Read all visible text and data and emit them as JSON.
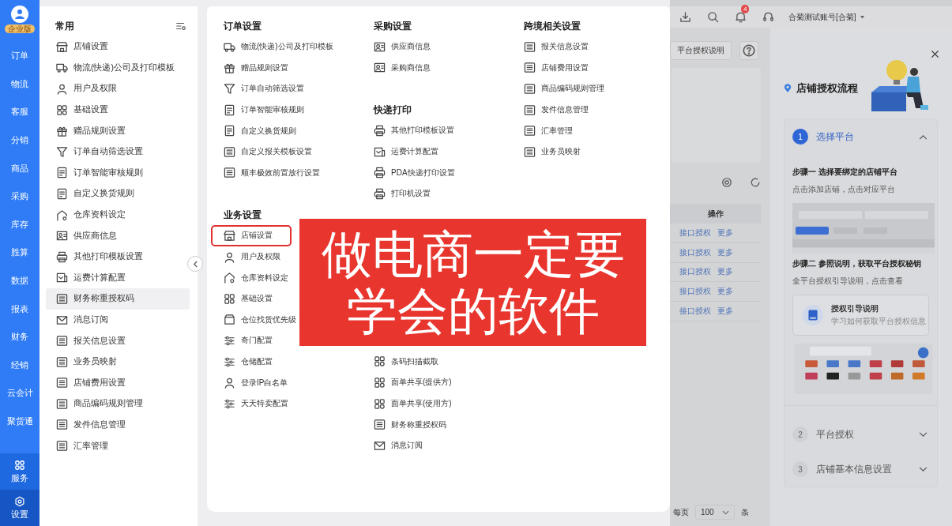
{
  "sidebar": {
    "logo_badge": "企业版",
    "items": [
      {
        "label": "订单",
        "selected": false
      },
      {
        "label": "物流",
        "selected": false
      },
      {
        "label": "客服",
        "selected": false
      },
      {
        "label": "分销",
        "selected": false
      },
      {
        "label": "商品",
        "selected": false
      },
      {
        "label": "采购",
        "selected": false
      },
      {
        "label": "库存",
        "selected": false
      },
      {
        "label": "胜算",
        "selected": false
      },
      {
        "label": "数据",
        "selected": false
      },
      {
        "label": "报表",
        "selected": false
      },
      {
        "label": "财务",
        "selected": false
      },
      {
        "label": "经销",
        "selected": false
      },
      {
        "label": "云会计",
        "selected": false
      },
      {
        "label": "聚货通",
        "selected": false
      }
    ],
    "bottom_items": [
      {
        "label": "服务",
        "kind": "apps",
        "selected": false
      },
      {
        "label": "设置",
        "kind": "settings",
        "selected": true
      }
    ]
  },
  "common_panel": {
    "title": "常用",
    "items": [
      {
        "label": "店铺设置",
        "kind": "store",
        "highlighted": false
      },
      {
        "label": "物流(快递)公司及打印模板",
        "kind": "truck",
        "highlighted": false
      },
      {
        "label": "用户及权限",
        "kind": "user",
        "highlighted": false
      },
      {
        "label": "基础设置",
        "kind": "grid",
        "highlighted": false
      },
      {
        "label": "赠品规则设置",
        "kind": "gift",
        "highlighted": false
      },
      {
        "label": "订单自动筛选设置",
        "kind": "filter",
        "highlighted": false
      },
      {
        "label": "订单智能审核规则",
        "kind": "note",
        "highlighted": false
      },
      {
        "label": "自定义换货规则",
        "kind": "note",
        "highlighted": false
      },
      {
        "label": "仓库资料设定",
        "kind": "house",
        "highlighted": false
      },
      {
        "label": "供应商信息",
        "kind": "card",
        "highlighted": false
      },
      {
        "label": "其他打印模板设置",
        "kind": "printer",
        "highlighted": false
      },
      {
        "label": "运费计算配置",
        "kind": "freight",
        "highlighted": false
      },
      {
        "label": "财务称重授权码",
        "kind": "doc",
        "highlighted": true
      },
      {
        "label": "消息订阅",
        "kind": "mail",
        "highlighted": false
      },
      {
        "label": "报关信息设置",
        "kind": "doc",
        "highlighted": false
      },
      {
        "label": "业务员映射",
        "kind": "doc",
        "highlighted": false
      },
      {
        "label": "店铺费用设置",
        "kind": "doc",
        "highlighted": false
      },
      {
        "label": "商品编码规则管理",
        "kind": "doc",
        "highlighted": false
      },
      {
        "label": "发件信息管理",
        "kind": "doc",
        "highlighted": false
      },
      {
        "label": "汇率管理",
        "kind": "doc",
        "highlighted": false
      }
    ]
  },
  "settings_panel": {
    "columns": [
      {
        "groups": [
          {
            "heading": "订单设置",
            "items": [
              {
                "label": "物流(快递)公司及打印模板",
                "kind": "truck"
              },
              {
                "label": "赠品规则设置",
                "kind": "gift"
              },
              {
                "label": "订单自动筛选设置",
                "kind": "filter"
              },
              {
                "label": "订单智能审核规则",
                "kind": "note"
              },
              {
                "label": "自定义换货规则",
                "kind": "note"
              },
              {
                "label": "自定义报关模板设置",
                "kind": "doc"
              },
              {
                "label": "顺丰极效前置放行设置",
                "kind": "doc"
              }
            ]
          },
          {
            "heading": "业务设置",
            "items": [
              {
                "label": "店铺设置",
                "kind": "store",
                "outlined": true
              },
              {
                "label": "用户及权限",
                "kind": "user",
                "outlined": false
              },
              {
                "label": "仓库资料设定",
                "kind": "house",
                "outlined": false
              },
              {
                "label": "基础设置",
                "kind": "grid",
                "outlined": false
              },
              {
                "label": "仓位找货优先级",
                "kind": "box",
                "outlined": false
              },
              {
                "label": "奇门配置",
                "kind": "sliders",
                "outlined": false
              },
              {
                "label": "仓储配置",
                "kind": "sliders",
                "outlined": false
              },
              {
                "label": "登录IP白名单",
                "kind": "user",
                "outlined": false
              },
              {
                "label": "天天特卖配置",
                "kind": "sliders",
                "outlined": false
              }
            ]
          }
        ]
      },
      {
        "groups": [
          {
            "heading": "采购设置",
            "items": [
              {
                "label": "供应商信息",
                "kind": "card"
              },
              {
                "label": "采购商信息",
                "kind": "card"
              }
            ]
          },
          {
            "heading": "快递打印",
            "items": [
              {
                "label": "其他打印模板设置",
                "kind": "printer"
              },
              {
                "label": "运费计算配置",
                "kind": "freight"
              },
              {
                "label": "PDA快递打印设置",
                "kind": "printer"
              },
              {
                "label": "打印机设置",
                "kind": "printer"
              }
            ]
          },
          {
            "items": [
              {
                "label": "条码扫描截取",
                "kind": "grid"
              },
              {
                "label": "面单共享(提供方)",
                "kind": "grid"
              },
              {
                "label": "面单共享(使用方)",
                "kind": "grid"
              },
              {
                "label": "财务称重授权码",
                "kind": "doc"
              },
              {
                "label": "消息订阅",
                "kind": "mail"
              }
            ]
          }
        ]
      },
      {
        "groups": [
          {
            "heading": "跨境相关设置",
            "items": [
              {
                "label": "报关信息设置",
                "kind": "doc"
              },
              {
                "label": "店铺费用设置",
                "kind": "doc"
              },
              {
                "label": "商品编码规则管理",
                "kind": "doc"
              },
              {
                "label": "发件信息管理",
                "kind": "doc"
              },
              {
                "label": "汇率管理",
                "kind": "doc"
              },
              {
                "label": "业务员映射",
                "kind": "doc"
              }
            ]
          }
        ]
      }
    ]
  },
  "caption": {
    "lines": [
      "做电商一定要",
      "学会的软件"
    ]
  },
  "top_bar": {
    "notification_count": "4",
    "account": "合菊测试账号[合菊]"
  },
  "main": {
    "button": "平台授权说明",
    "table": {
      "columns": [
        "操作"
      ],
      "rows": [
        {
          "actions": [
            "接口授权",
            "更多"
          ]
        },
        {
          "actions": [
            "接口授权",
            "更多"
          ]
        },
        {
          "actions": [
            "接口授权",
            "更多"
          ]
        },
        {
          "actions": [
            "接口授权",
            "更多"
          ]
        },
        {
          "actions": [
            "接口授权",
            "更多"
          ]
        }
      ]
    },
    "pagination": {
      "per_page_label": "每页",
      "page_size": "100",
      "unit": "条"
    }
  },
  "drawer": {
    "title": "店铺授权流程",
    "steps": [
      {
        "number": "1",
        "title": "选择平台",
        "expanded": true,
        "sections": [
          {
            "heading": "步骤一 选择要绑定的店铺平台",
            "text": "点击添加店铺，点击对应平台",
            "kind": "screenshot"
          },
          {
            "heading": "步骤二 参照说明，获取平台授权秘钥",
            "text": "全平台授权引导说明，点击查看",
            "guide": {
              "title": "授权引导说明",
              "subtitle": "学习如何获取平台授权信息"
            },
            "kind": "platforms"
          }
        ]
      },
      {
        "number": "2",
        "title": "平台授权",
        "expanded": false
      },
      {
        "number": "3",
        "title": "店铺基本信息设置",
        "expanded": false
      }
    ]
  }
}
